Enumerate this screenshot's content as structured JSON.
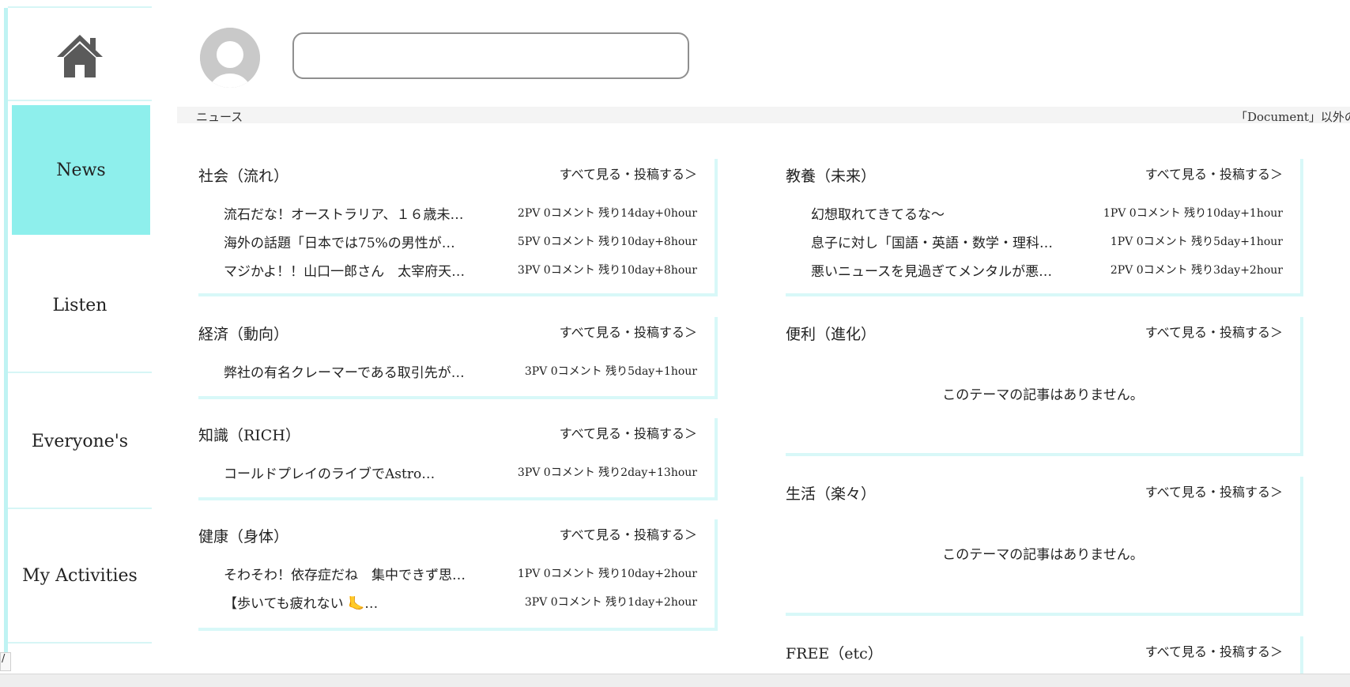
{
  "sidebar": {
    "items": [
      {
        "label": "News"
      },
      {
        "label": "Listen"
      },
      {
        "label": "Everyone's"
      },
      {
        "label": "My Activities"
      }
    ]
  },
  "header": {
    "search_value": ""
  },
  "ticker": {
    "label": "ニュース",
    "text": "「Document」以外の"
  },
  "sections": {
    "shakai": {
      "title": "社会（流れ）",
      "link": "すべて見る・投稿する＞",
      "articles": [
        {
          "title": "流石だな！オーストラリア、１６歳未…",
          "meta": "2PV 0コメント 残り14day+0hour"
        },
        {
          "title": "海外の話題「日本では75%の男性が…",
          "meta": "5PV 0コメント 残り10day+8hour"
        },
        {
          "title": "マジかよ！！山口一郎さん　太宰府天…",
          "meta": "3PV 0コメント 残り10day+8hour"
        }
      ]
    },
    "keizai": {
      "title": "経済（動向）",
      "link": "すべて見る・投稿する＞",
      "articles": [
        {
          "title": "弊社の有名クレーマーである取引先が…",
          "meta": "3PV 0コメント 残り5day+1hour"
        }
      ]
    },
    "chishiki": {
      "title": "知識（RICH）",
      "link": "すべて見る・投稿する＞",
      "articles": [
        {
          "title": "コールドプレイのライブでAstro…",
          "meta": "3PV 0コメント 残り2day+13hour"
        }
      ]
    },
    "kenko": {
      "title": "健康（身体）",
      "link": "すべて見る・投稿する＞",
      "articles": [
        {
          "title": "そわそわ！依存症だね　集中できず思…",
          "meta": "1PV 0コメント 残り10day+2hour"
        },
        {
          "title": "【歩いても疲れない 🦶…",
          "meta": "3PV 0コメント 残り1day+2hour"
        }
      ]
    },
    "kyoyo": {
      "title": "教養（未来）",
      "link": "すべて見る・投稿する＞",
      "articles": [
        {
          "title": "幻想取れてきてるな〜",
          "meta": "1PV 0コメント 残り10day+1hour"
        },
        {
          "title": "息子に対し「国語・英語・数学・理科…",
          "meta": "1PV 0コメント 残り5day+1hour"
        },
        {
          "title": "悪いニュースを見過ぎてメンタルが悪…",
          "meta": "2PV 0コメント 残り3day+2hour"
        }
      ]
    },
    "benri": {
      "title": "便利（進化）",
      "link": "すべて見る・投稿する＞",
      "empty": "このテーマの記事はありません。"
    },
    "seikatsu": {
      "title": "生活（楽々）",
      "link": "すべて見る・投稿する＞",
      "empty": "このテーマの記事はありません。"
    },
    "free": {
      "title": "FREE（etc）",
      "link": "すべて見る・投稿する＞"
    }
  },
  "status": {
    "url": "/"
  },
  "colors": {
    "accent": "#8eefec",
    "divider": "#d8f8f8",
    "sidebar_line": "#bff3f3"
  },
  "icons": [
    "home-icon",
    "avatar-icon"
  ]
}
